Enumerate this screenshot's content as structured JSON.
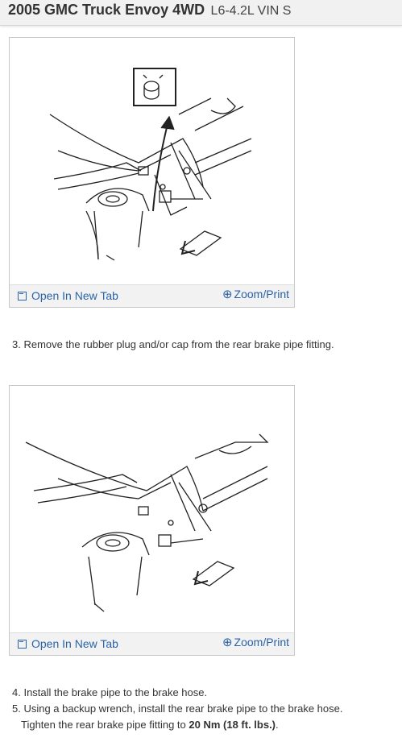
{
  "header": {
    "title": "2005 GMC Truck Envoy 4WD",
    "subtitle": "L6-4.2L VIN S"
  },
  "figures": [
    {
      "open_tab_label": "Open In New Tab",
      "zoom_label": "Zoom/Print",
      "open_icon": "open-new-tab-icon",
      "zoom_icon": "zoom-in-icon"
    },
    {
      "open_tab_label": "Open In New Tab",
      "zoom_label": "Zoom/Print",
      "open_icon": "open-new-tab-icon",
      "zoom_icon": "zoom-in-icon"
    }
  ],
  "steps": {
    "step3": "3. Remove the rubber plug and/or cap from the rear brake pipe fitting.",
    "step4": "4. Install the brake pipe to the brake hose.",
    "step5": "5. Using a backup wrench, install the rear brake pipe to the brake hose.",
    "step5_note_prefix": "Tighten the rear brake pipe fitting to ",
    "step5_note_torque": "20 Nm (18 ft. lbs.)",
    "step5_note_suffix": "."
  },
  "colors": {
    "link": "#2a63a6",
    "header_bg": "#f1f1f1",
    "bar_bg": "#f2f2f2"
  }
}
